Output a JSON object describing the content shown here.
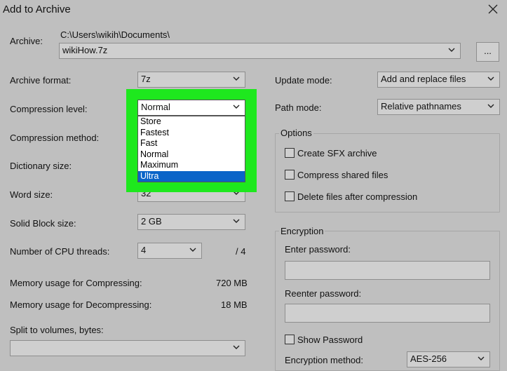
{
  "window": {
    "title": "Add to Archive"
  },
  "archive": {
    "label": "Archive:",
    "path": "C:\\Users\\wikih\\Documents\\",
    "filename": "wikiHow.7z",
    "browse_label": "..."
  },
  "left": {
    "archive_format": {
      "label": "Archive format:",
      "value": "7z"
    },
    "compression_level": {
      "label": "Compression level:",
      "value": "Normal",
      "options": [
        "Store",
        "Fastest",
        "Fast",
        "Normal",
        "Maximum",
        "Ultra"
      ],
      "highlighted": "Ultra"
    },
    "compression_method": {
      "label": "Compression method:"
    },
    "dictionary_size": {
      "label": "Dictionary size:"
    },
    "word_size": {
      "label": "Word size:",
      "value": "32"
    },
    "solid_block": {
      "label": "Solid Block size:",
      "value": "2 GB"
    },
    "cpu_threads": {
      "label": "Number of CPU threads:",
      "value": "4",
      "max": "/ 4"
    },
    "mem_compress": {
      "label": "Memory usage for Compressing:",
      "value": "720 MB"
    },
    "mem_decompress": {
      "label": "Memory usage for Decompressing:",
      "value": "18 MB"
    },
    "split": {
      "label": "Split to volumes, bytes:",
      "value": ""
    }
  },
  "right": {
    "update_mode": {
      "label": "Update mode:",
      "value": "Add and replace files"
    },
    "path_mode": {
      "label": "Path mode:",
      "value": "Relative pathnames"
    },
    "options": {
      "title": "Options",
      "sfx": "Create SFX archive",
      "shared": "Compress shared files",
      "delete": "Delete files after compression"
    },
    "encryption": {
      "title": "Encryption",
      "enter_label": "Enter password:",
      "reenter_label": "Reenter password:",
      "show_password": "Show Password",
      "method_label": "Encryption method:",
      "method_value": "AES-256"
    }
  },
  "colors": {
    "highlight_box": "#1ee81e",
    "selection": "#0a64c8"
  }
}
